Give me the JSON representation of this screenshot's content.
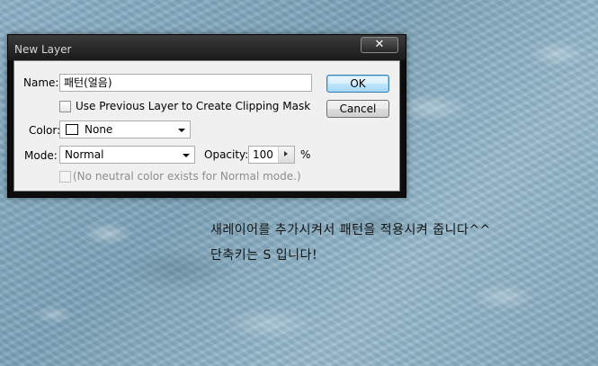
{
  "dialog": {
    "title": "New Layer",
    "close_glyph": "✕",
    "name_label": "Name:",
    "name_value": "패턴(얼음)",
    "clipping_label": "Use Previous Layer to Create Clipping Mask",
    "clipping_checked": false,
    "color_label": "Color:",
    "color_value": "None",
    "mode_label": "Mode:",
    "mode_value": "Normal",
    "opacity_label": "Opacity:",
    "opacity_value": "100",
    "opacity_unit": "%",
    "neutral_label": "(No neutral color exists for Normal mode.)",
    "neutral_checked": false,
    "ok_label": "OK",
    "cancel_label": "Cancel"
  },
  "annotation": {
    "line1": "새레이어를 추가시켜서 패턴을 적용시켜 줍니다^^",
    "line2": "단축키는 S 입니다!"
  },
  "colors": {
    "background": "#8fb3c7",
    "dialog_frame": "#0d0d0d",
    "client": "#f0f0f0"
  }
}
